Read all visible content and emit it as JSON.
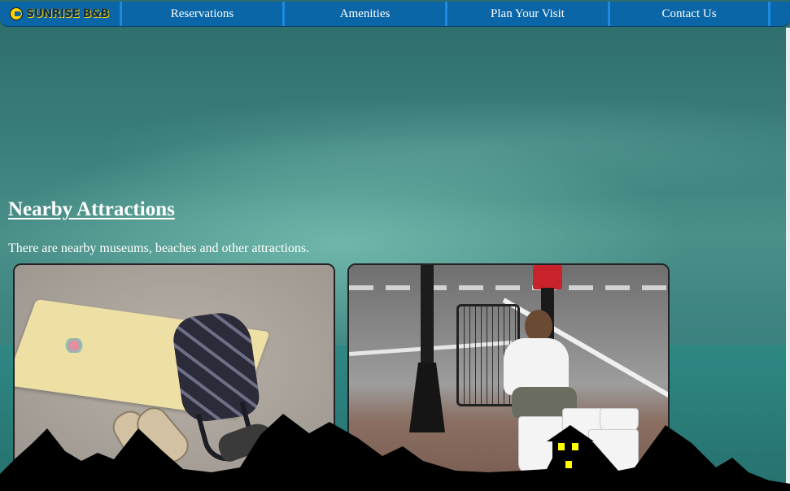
{
  "nav": {
    "logo_text": "SUNRISE B&B",
    "items": [
      {
        "label": "Reservations"
      },
      {
        "label": "Amenities"
      },
      {
        "label": "Plan Your Visit"
      },
      {
        "label": "Contact Us"
      }
    ]
  },
  "main": {
    "title": "Nearby Attractions",
    "intro": "There are nearby museums, beaches and other attractions.",
    "photos": [
      {
        "subject": "beach-towel-backpack-photo"
      },
      {
        "subject": "street-drummer-photo"
      }
    ]
  },
  "colors": {
    "nav_bg": "#0a66a6",
    "nav_divider": "#1b8ae0",
    "background": "#3a7f7b",
    "skyline": "#000000",
    "window_light": "#ffff00"
  }
}
